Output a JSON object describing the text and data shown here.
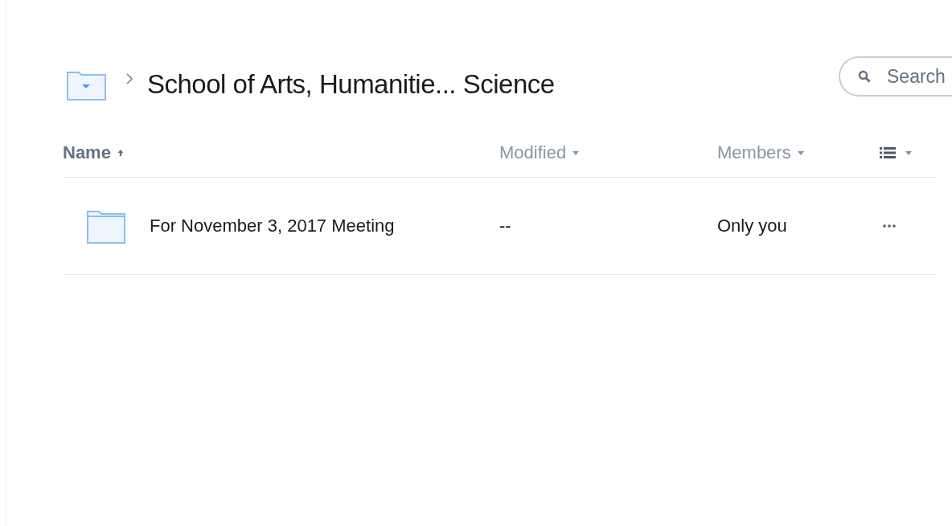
{
  "breadcrumb": {
    "title": "School of Arts, Humanitie... Science"
  },
  "search": {
    "placeholder": "Search"
  },
  "table": {
    "columns": [
      {
        "label": "Name",
        "selected": true
      },
      {
        "label": "Modified",
        "selected": false
      },
      {
        "label": "Members",
        "selected": false
      }
    ],
    "rows": [
      {
        "name": "For November 3, 2017 Meeting",
        "modified": "--",
        "members": "Only you"
      }
    ]
  }
}
